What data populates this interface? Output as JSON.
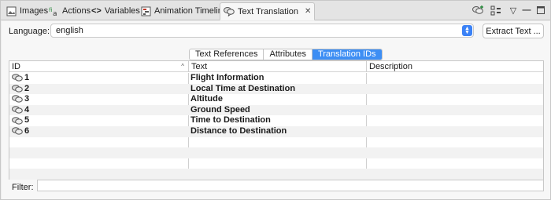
{
  "tabs": [
    {
      "label": "Images",
      "icon": "images-icon",
      "active": false
    },
    {
      "label": "Actions",
      "icon": "actions-icon",
      "active": false
    },
    {
      "label": "Variables",
      "icon": "variables-icon",
      "active": false
    },
    {
      "label": "Animation Timeline",
      "icon": "timeline-icon",
      "active": false
    },
    {
      "label": "Text Translation",
      "icon": "speech-bubbles-icon",
      "active": true
    }
  ],
  "language": {
    "label": "Language:",
    "selected": "english"
  },
  "extract_button": "Extract Text ...",
  "subtabs": [
    {
      "label": "Text References",
      "selected": false
    },
    {
      "label": "Attributes",
      "selected": false
    },
    {
      "label": "Translation IDs",
      "selected": true
    }
  ],
  "table": {
    "columns": [
      "ID",
      "Text",
      "Description"
    ],
    "sort_indicator": "^",
    "rows": [
      {
        "id": "1",
        "text": "Flight Information",
        "description": ""
      },
      {
        "id": "2",
        "text": "Local Time at Destination",
        "description": ""
      },
      {
        "id": "3",
        "text": "Altitude",
        "description": ""
      },
      {
        "id": "4",
        "text": "Ground Speed",
        "description": ""
      },
      {
        "id": "5",
        "text": "Time to Destination",
        "description": ""
      },
      {
        "id": "6",
        "text": "Distance to Destination",
        "description": ""
      }
    ],
    "empty_rows": 4
  },
  "filter": {
    "label": "Filter:",
    "value": ""
  },
  "colors": {
    "accent": "#3d8ef4"
  }
}
